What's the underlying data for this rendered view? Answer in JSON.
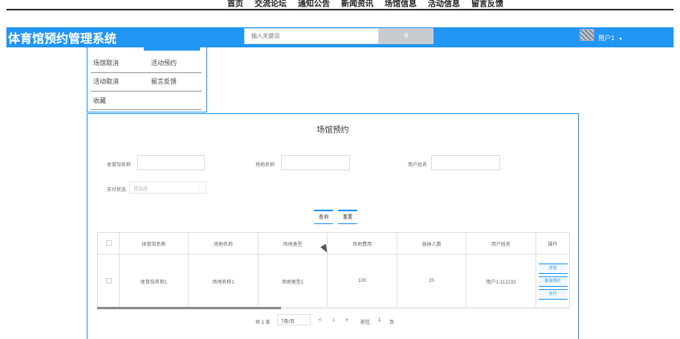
{
  "topnav": {
    "items": [
      "首页",
      "交流论坛",
      "通知公告",
      "新闻资讯",
      "场馆信息",
      "活动信息",
      "留言反馈"
    ]
  },
  "header": {
    "brand": "体育馆预约管理系统",
    "search_placeholder": "输入关键词",
    "search_icon": "search-icon",
    "username": "用户1",
    "caret": "▾"
  },
  "dropdown": {
    "items": [
      "场馆取消",
      "活动预约",
      "活动取消",
      "留言反馈",
      "收藏"
    ]
  },
  "page": {
    "title": "场馆预约"
  },
  "filters": {
    "venue_name_label": "体育馆名称",
    "field_name_label": "场地名称",
    "user_name_label": "用户姓名",
    "pay_status_label": "支付状态",
    "pay_status_placeholder": "请选择",
    "query_button": "查询",
    "reset_button": "重置"
  },
  "table": {
    "columns": [
      "体育馆名称",
      "场地名称",
      "场地类型",
      "场地费用",
      "容纳人数",
      "用户姓名",
      "操作"
    ],
    "rows": [
      {
        "venue": "体育馆名称1",
        "field": "场地名称1",
        "type": "场地类型1",
        "fee": "100",
        "capacity": "20",
        "user": "用户1-112233",
        "actions": [
          "详情",
          "取消预约",
          "支付"
        ]
      }
    ],
    "scroll_position": 0.39
  },
  "pager": {
    "total": "共 1 条",
    "page_size": "7条/页",
    "prev": "<",
    "current": "1",
    "next": ">",
    "goto_label": "前往",
    "goto_value": "1",
    "page_unit": "页"
  },
  "colors": {
    "primary": "#2196f3",
    "search_button": "#c8ccd1"
  }
}
